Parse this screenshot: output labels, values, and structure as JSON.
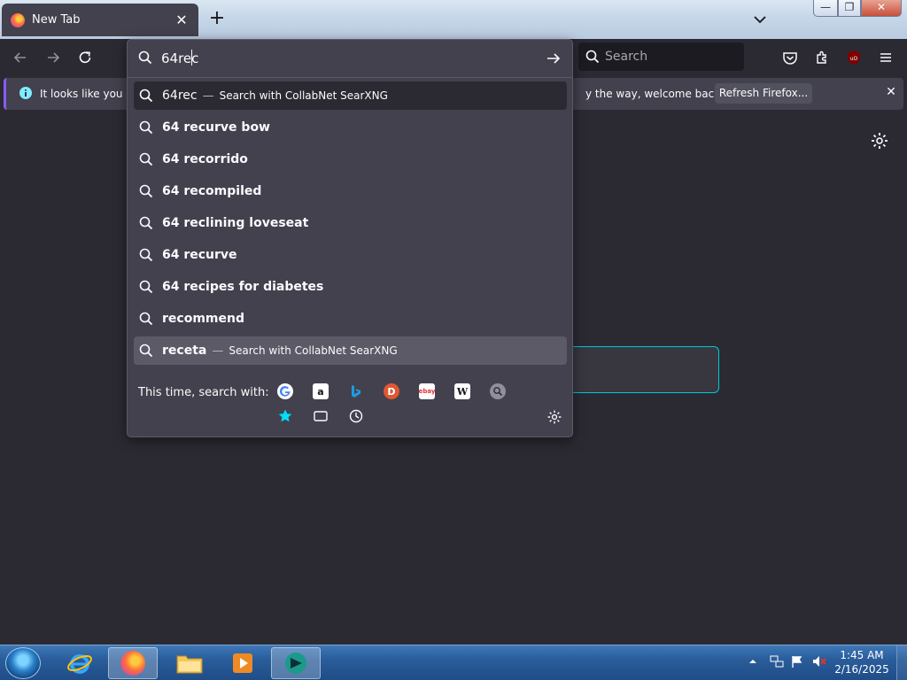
{
  "tab": {
    "title": "New Tab",
    "close_glyph": "✕"
  },
  "titlebar": {
    "new_tab_glyph": "+",
    "minimize_glyph": "—",
    "maximize_glyph": "❐",
    "close_glyph": "✕"
  },
  "navbar": {
    "search_placeholder": "Search"
  },
  "notification": {
    "text_left": "It looks like you ha",
    "text_right": "y the way, welcome back!",
    "button_label": "Refresh Firefox...",
    "close_glyph": "✕"
  },
  "urlbar": {
    "value": "64rec",
    "suggestions": [
      {
        "label": "64rec",
        "dash": "—",
        "action": "Search with CollabNet SearXNG",
        "state": "first"
      },
      {
        "label": "64 recurve bow"
      },
      {
        "label": "64 recorrido"
      },
      {
        "label": "64 recompiled"
      },
      {
        "label": "64 reclining loveseat"
      },
      {
        "label": "64 recurve"
      },
      {
        "label": "64 recipes for diabetes"
      },
      {
        "label": "recommend"
      },
      {
        "label": "receta",
        "dash": "—",
        "action": "Search with CollabNet SearXNG",
        "state": "selected"
      }
    ],
    "one_off_label": "This time, search with:",
    "engines": [
      "google-icon",
      "amazon-icon",
      "bing-icon",
      "duckduckgo-icon",
      "ebay-icon",
      "wikipedia-icon",
      "searxng-icon",
      "bookmarks-icon",
      "tabs-icon",
      "history-icon"
    ]
  },
  "taskbar": {
    "apps": [
      "internet-explorer-icon",
      "firefox-icon",
      "file-explorer-icon",
      "media-player-icon",
      "app-icon"
    ],
    "clock_time": "1:45 AM",
    "clock_date": "2/16/2025"
  },
  "colors": {
    "accent": "#00c8d7",
    "panel": "#42414d",
    "selected": "#5b5a66"
  }
}
